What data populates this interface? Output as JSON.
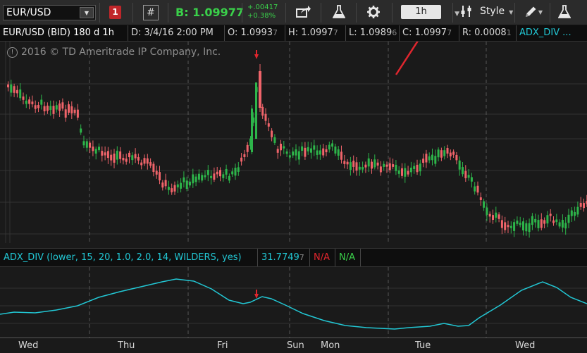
{
  "toolbar": {
    "symbol": "EUR/USD",
    "alert_badge": "1",
    "hash_label": "#",
    "bid": "B: 1.09977",
    "change_abs": "+.00417",
    "change_pct": "+0.38%",
    "timeframe": "1h",
    "style_label": "Style",
    "icons": [
      "share-icon",
      "flask-icon",
      "gear-icon",
      "gear-settings-icon",
      "pencil-icon",
      "flask-icon"
    ]
  },
  "info": {
    "title": "EUR/USD (BID) 180 d 1h",
    "date": "D: 3/4/16 2:00 PM",
    "open": "O: 1.0993",
    "open_tail": "7",
    "high": "H: 1.0997",
    "high_tail": "7",
    "low": "L: 1.0989",
    "low_tail": "6",
    "close": "C: 1.0997",
    "close_tail": "7",
    "range": "R: 0.0008",
    "range_tail": "1",
    "study": "ADX_DIV ..."
  },
  "copyright": "2016 © TD Ameritrade IP Company, Inc.",
  "lower": {
    "study_label": "ADX_DIV (lower, 15, 20, 1.0, 2.0, 14, WILDERS, yes)",
    "value": "31.7749",
    "value_tail": "7",
    "na_red": "N/A",
    "na_green": "N/A"
  },
  "x_axis": [
    "Wed",
    "Thu",
    "Fri",
    "Sun",
    "Mon",
    "Tue",
    "Wed"
  ],
  "colors": {
    "up": "#2db54a",
    "down": "#f0646a",
    "adx_line": "#22c7d4",
    "accent_arrow": "#e0262e"
  }
}
